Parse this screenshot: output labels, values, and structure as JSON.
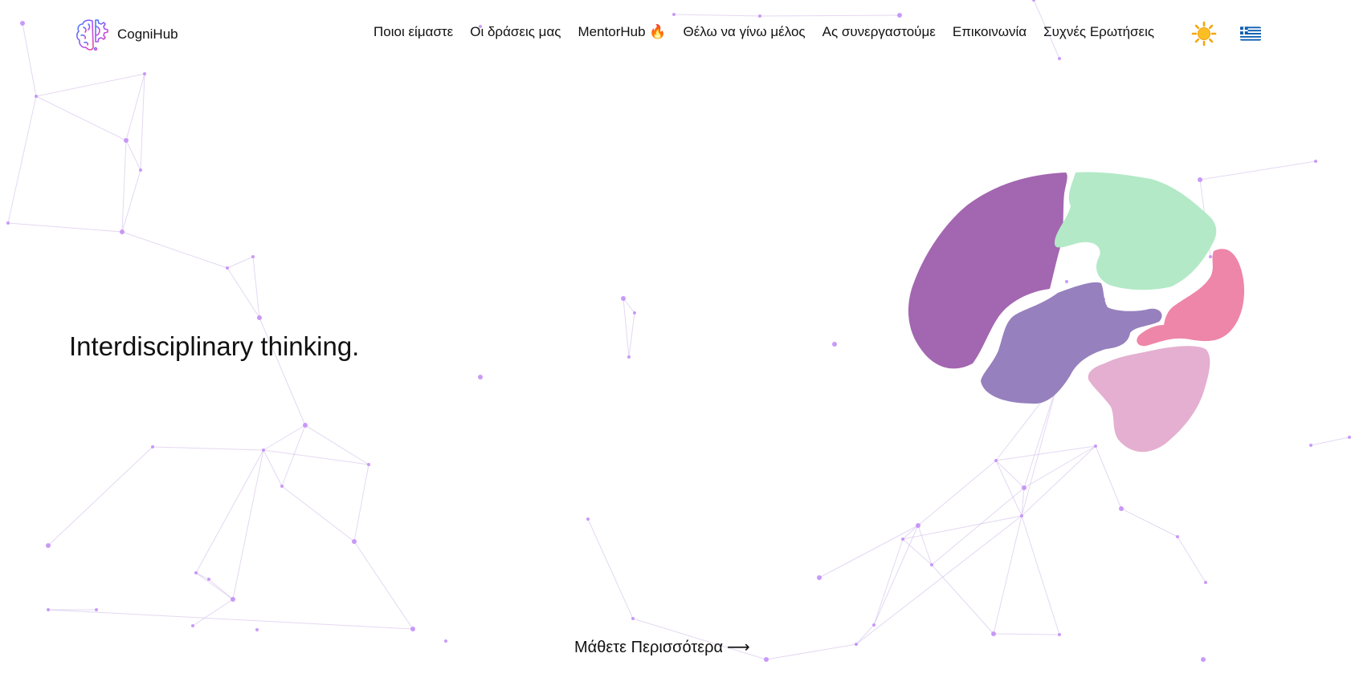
{
  "brand": {
    "name": "CogniHub",
    "logo_icon": "brain-gear-logo-icon",
    "logo_gradient": [
      "#3b82f6",
      "#a855f7",
      "#ec4899"
    ]
  },
  "nav": {
    "items": [
      {
        "label": "Ποιοι είμαστε"
      },
      {
        "label": "Οι δράσεις μας"
      },
      {
        "label": "MentorHub 🔥"
      },
      {
        "label": "Θέλω να γίνω μέλος"
      },
      {
        "label": "Ας συνεργαστούμε"
      },
      {
        "label": "Επικοινωνία"
      },
      {
        "label": "Συχνές Ερωτήσεις"
      }
    ],
    "theme_icon": "sun-icon",
    "language_icon": "greek-flag-icon"
  },
  "hero": {
    "title": "Interdisciplinary thinking.",
    "brain_icon": "colored-brain-illustration",
    "brain_colors": {
      "frontal": "#a366b0",
      "parietal": "#b3e9c7",
      "temporal": "#9680bd",
      "occipital": "#ee86a9",
      "cerebellum": "#e4afd0"
    }
  },
  "cta": {
    "label": "Μάθετε Περισσότερα",
    "arrow": "⟶"
  },
  "background": {
    "pattern": "particle-network",
    "node_color": "#c08af7",
    "line_color": "#cdb8e8"
  }
}
